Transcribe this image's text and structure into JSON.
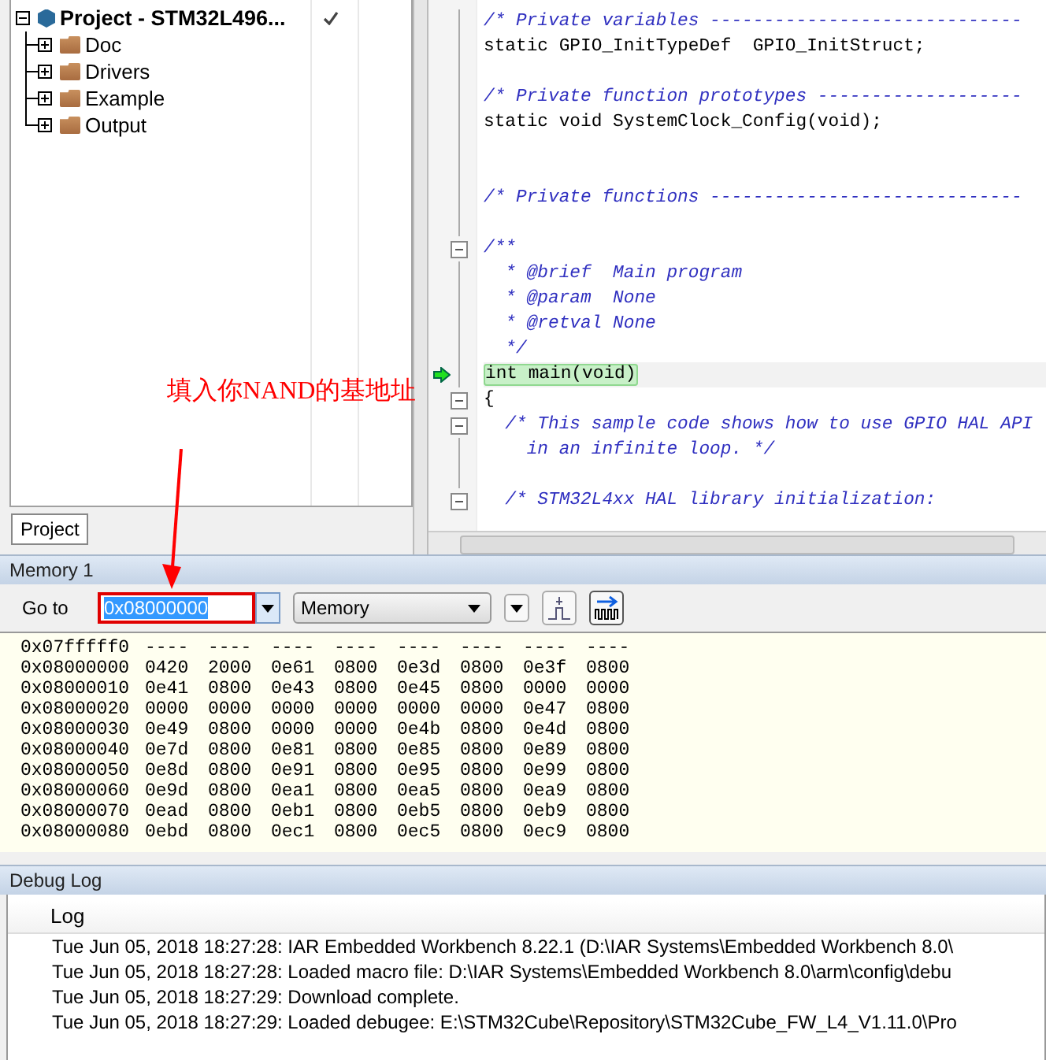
{
  "workspace": {
    "tree": [
      {
        "label": "Project - STM32L496...",
        "expanded": true,
        "checked": true,
        "children": [
          {
            "label": "Doc",
            "expanded": false
          },
          {
            "label": "Drivers",
            "expanded": false
          },
          {
            "label": "Example",
            "expanded": false
          },
          {
            "label": "Output",
            "expanded": false
          }
        ]
      }
    ],
    "tabs": [
      {
        "label": "Project",
        "selected": true
      }
    ]
  },
  "editor": {
    "lines": [
      {
        "text": "/* Private variables -----------------------------",
        "kind": "comment",
        "fold": false,
        "current": false
      },
      {
        "text": "static GPIO_InitTypeDef  GPIO_InitStruct;",
        "kind": "code",
        "fold": false,
        "current": false
      },
      {
        "kind": "blank",
        "fold": false,
        "current": false
      },
      {
        "text": "/* Private function prototypes -------------------",
        "kind": "comment",
        "fold": false,
        "current": false
      },
      {
        "text": "static void SystemClock_Config(void);",
        "kind": "code",
        "fold": false,
        "current": false
      },
      {
        "kind": "blank",
        "fold": false,
        "current": false
      },
      {
        "kind": "blank",
        "fold": false,
        "current": false
      },
      {
        "text": "/* Private functions -----------------------------",
        "kind": "comment",
        "fold": false,
        "current": false
      },
      {
        "kind": "blank",
        "fold": false,
        "current": false
      },
      {
        "text": "/**",
        "kind": "comment",
        "fold": true,
        "current": false
      },
      {
        "text": "  * @brief  Main program",
        "kind": "comment",
        "fold": false,
        "current": false
      },
      {
        "text": "  * @param  None",
        "kind": "comment",
        "fold": false,
        "current": false
      },
      {
        "text": "  * @retval None",
        "kind": "comment",
        "fold": false,
        "current": false
      },
      {
        "text": "  */",
        "kind": "comment",
        "fold": false,
        "current": false
      },
      {
        "text": "int main(void)",
        "kind": "code",
        "fold": false,
        "current": true
      },
      {
        "text": "{",
        "kind": "code",
        "fold": true,
        "current": false
      },
      {
        "text": "  /* This sample code shows how to use GPIO HAL API",
        "kind": "comment",
        "fold": true,
        "current": false
      },
      {
        "text": "    in an infinite loop. */",
        "kind": "comment",
        "fold": false,
        "current": false
      },
      {
        "kind": "blank",
        "fold": false,
        "current": false
      },
      {
        "text": "  /* STM32L4xx HAL library initialization:",
        "kind": "comment",
        "fold": true,
        "current": false
      }
    ]
  },
  "annotation": {
    "text": "填入你NAND的基地址"
  },
  "memory": {
    "title": "Memory 1",
    "goto_label": "Go to",
    "address": "0x08000000",
    "zone": "Memory",
    "rows": [
      {
        "address": "0x07fffff0",
        "words": [
          "----",
          "----",
          "----",
          "----",
          "----",
          "----",
          "----",
          "----"
        ]
      },
      {
        "address": "0x08000000",
        "words": [
          "0420",
          "2000",
          "0e61",
          "0800",
          "0e3d",
          "0800",
          "0e3f",
          "0800"
        ]
      },
      {
        "address": "0x08000010",
        "words": [
          "0e41",
          "0800",
          "0e43",
          "0800",
          "0e45",
          "0800",
          "0000",
          "0000"
        ]
      },
      {
        "address": "0x08000020",
        "words": [
          "0000",
          "0000",
          "0000",
          "0000",
          "0000",
          "0000",
          "0e47",
          "0800"
        ]
      },
      {
        "address": "0x08000030",
        "words": [
          "0e49",
          "0800",
          "0000",
          "0000",
          "0e4b",
          "0800",
          "0e4d",
          "0800"
        ]
      },
      {
        "address": "0x08000040",
        "words": [
          "0e7d",
          "0800",
          "0e81",
          "0800",
          "0e85",
          "0800",
          "0e89",
          "0800"
        ]
      },
      {
        "address": "0x08000050",
        "words": [
          "0e8d",
          "0800",
          "0e91",
          "0800",
          "0e95",
          "0800",
          "0e99",
          "0800"
        ]
      },
      {
        "address": "0x08000060",
        "words": [
          "0e9d",
          "0800",
          "0ea1",
          "0800",
          "0ea5",
          "0800",
          "0ea9",
          "0800"
        ]
      },
      {
        "address": "0x08000070",
        "words": [
          "0ead",
          "0800",
          "0eb1",
          "0800",
          "0eb5",
          "0800",
          "0eb9",
          "0800"
        ]
      },
      {
        "address": "0x08000080",
        "words": [
          "0ebd",
          "0800",
          "0ec1",
          "0800",
          "0ec5",
          "0800",
          "0ec9",
          "0800"
        ]
      }
    ]
  },
  "debug_log": {
    "title": "Debug Log",
    "column": "Log",
    "entries": [
      "Tue Jun 05, 2018 18:27:28: IAR Embedded Workbench 8.22.1 (D:\\IAR Systems\\Embedded Workbench 8.0\\",
      "Tue Jun 05, 2018 18:27:28: Loaded macro file: D:\\IAR Systems\\Embedded Workbench 8.0\\arm\\config\\debu",
      "Tue Jun 05, 2018 18:27:29: Download complete.",
      "Tue Jun 05, 2018 18:27:29: Loaded debugee: E:\\STM32Cube\\Repository\\STM32Cube_FW_L4_V1.11.0\\Pro"
    ]
  }
}
